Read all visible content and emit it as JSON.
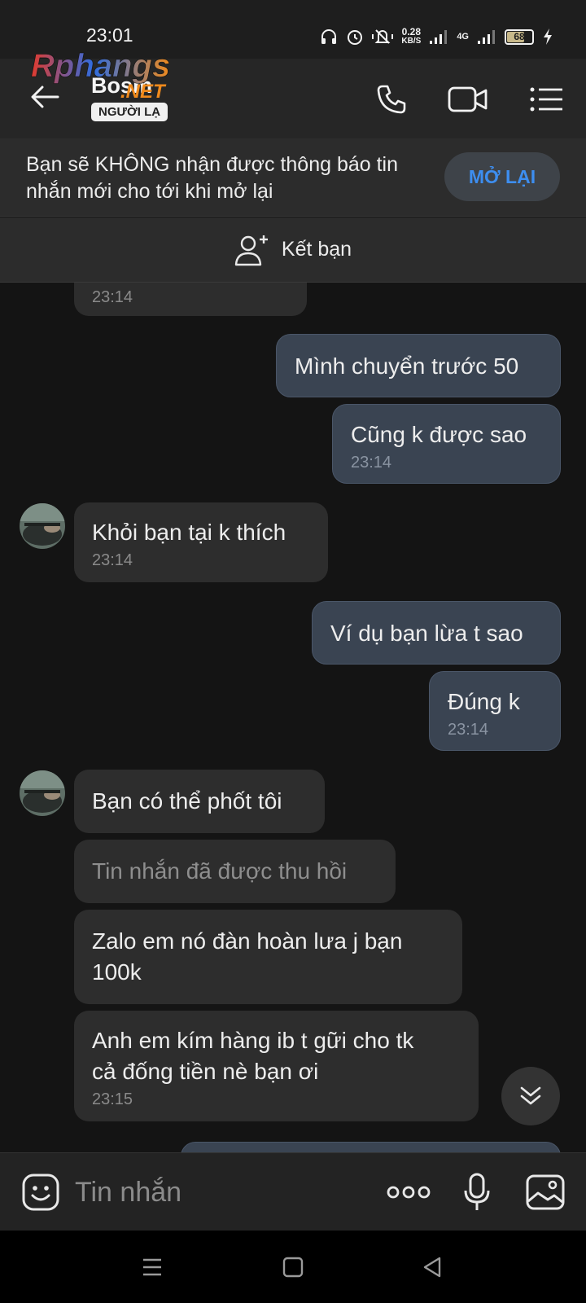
{
  "status_bar": {
    "time": "23:01",
    "net_speed_value": "0.28",
    "net_speed_unit": "KB/S",
    "network_type": "4G",
    "battery_level": "68"
  },
  "header": {
    "contact_name": "Bosm",
    "stranger_badge": "NGƯỜI LẠ",
    "watermark_main": "Rphangs",
    "watermark_sub": ".NET"
  },
  "notice": {
    "text": "Bạn sẽ KHÔNG nhận được thông báo tin nhắn mới cho tới khi mở lại",
    "button": "MỞ LẠI"
  },
  "add_friend": {
    "label": "Kết bạn"
  },
  "messages": [
    {
      "direction": "in",
      "text": "",
      "time": "23:14"
    },
    {
      "direction": "out",
      "text": "Mình chuyển trước 50",
      "time": ""
    },
    {
      "direction": "out",
      "text": "Cũng k được sao",
      "time": "23:14"
    },
    {
      "direction": "in",
      "text": "Khỏi bạn tại k thích",
      "time": "23:14"
    },
    {
      "direction": "out",
      "text": "Ví dụ bạn lừa t sao",
      "time": ""
    },
    {
      "direction": "out",
      "text": "Đúng k",
      "time": "23:14"
    },
    {
      "direction": "in",
      "text": "Bạn có thể phốt tôi",
      "time": ""
    },
    {
      "direction": "in",
      "text": "Tin nhắn đã được thu hồi",
      "time": ""
    },
    {
      "direction": "in",
      "text_line1": "Zalo em nó đàn hoàn lưa j bạn",
      "text_line2": "100k",
      "time": ""
    },
    {
      "direction": "in",
      "text_line1": "Anh em kím hàng ib t gữi cho tk",
      "text_line2": "cả đống tiền nè bạn ơi",
      "time": "23:15"
    }
  ],
  "composer": {
    "placeholder": "Tin nhắn"
  },
  "colors": {
    "accent": "#3d8ef0",
    "incoming_bubble": "#2d2d2d",
    "outgoing_bubble": "#3a4452"
  }
}
